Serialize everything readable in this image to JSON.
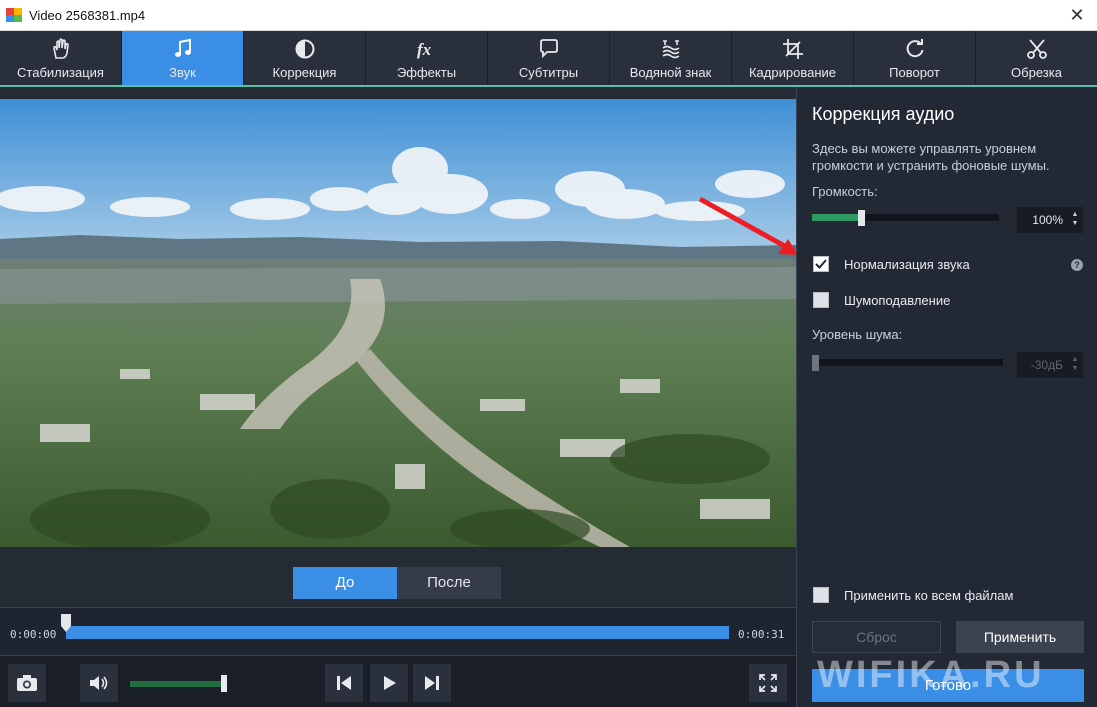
{
  "window": {
    "title": "Video 2568381.mp4"
  },
  "tabs": [
    {
      "label": "Стабилизация",
      "icon": "hand-icon",
      "active": false
    },
    {
      "label": "Звук",
      "icon": "music-note-icon",
      "active": true
    },
    {
      "label": "Коррекция",
      "icon": "contrast-icon",
      "active": false
    },
    {
      "label": "Эффекты",
      "icon": "fx-icon",
      "active": false
    },
    {
      "label": "Субтитры",
      "icon": "speech-bubble-icon",
      "active": false
    },
    {
      "label": "Водяной знак",
      "icon": "watermark-icon",
      "active": false
    },
    {
      "label": "Кадрирование",
      "icon": "crop-icon",
      "active": false
    },
    {
      "label": "Поворот",
      "icon": "rotate-icon",
      "active": false
    },
    {
      "label": "Обрезка",
      "icon": "scissors-icon",
      "active": false
    }
  ],
  "compare": {
    "before_label": "До",
    "after_label": "После",
    "selected": "До"
  },
  "timeline": {
    "start_time": "0:00:00",
    "end_time": "0:00:31"
  },
  "player": {
    "volume_level": 0.98
  },
  "panel": {
    "title": "Коррекция аудио",
    "description": "Здесь вы можете управлять уровнем громкости и устранить фоновые шумы.",
    "volume_label": "Громкость:",
    "volume_value": "100%",
    "volume_fraction": 0.26,
    "normalize_label": "Нормализация звука",
    "normalize_checked": true,
    "noise_reduction_label": "Шумоподавление",
    "noise_reduction_checked": false,
    "noise_level_label": "Уровень шума:",
    "noise_level_value": "-30дБ",
    "noise_level_fraction": 0.0,
    "apply_all_label": "Применить ко всем файлам",
    "apply_all_checked": false,
    "reset_label": "Сброс",
    "apply_label": "Применить",
    "done_label": "Готово"
  },
  "watermark": {
    "text": "WIFIKA.RU"
  },
  "colors": {
    "accent": "#3a8ee6",
    "tab_bar": "#2a303b",
    "panel_bg": "#222834",
    "slider_green": "#2f9b63"
  }
}
